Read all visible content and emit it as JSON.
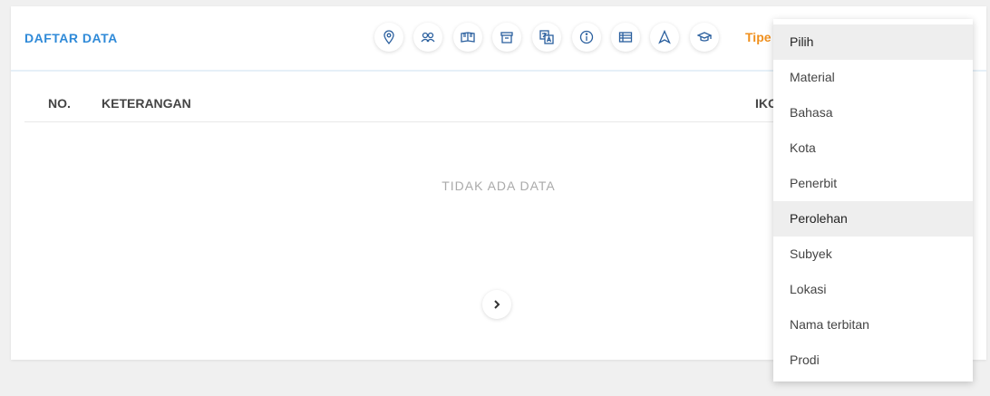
{
  "header": {
    "title": "DAFTAR DATA",
    "tipe_label": "Tipe"
  },
  "toolbar": {
    "icons": [
      {
        "name": "location-pin-icon"
      },
      {
        "name": "users-icon"
      },
      {
        "name": "book-open-icon"
      },
      {
        "name": "archive-box-icon"
      },
      {
        "name": "translate-icon"
      },
      {
        "name": "info-icon"
      },
      {
        "name": "table-icon"
      },
      {
        "name": "navigation-arrow-icon"
      },
      {
        "name": "graduation-cap-icon"
      }
    ]
  },
  "table": {
    "columns": [
      "NO.",
      "KETERANGAN",
      "IKO"
    ],
    "empty_text": "TIDAK ADA DATA"
  },
  "pagination": {
    "next_icon": "chevron-right-icon"
  },
  "dropdown": {
    "options": [
      "Pilih",
      "Material",
      "Bahasa",
      "Kota",
      "Penerbit",
      "Perolehan",
      "Subyek",
      "Lokasi",
      "Nama terbitan",
      "Prodi"
    ],
    "selected": "Pilih",
    "hovered": "Perolehan"
  },
  "colors": {
    "accent": "#2f8ad8",
    "orange": "#f0901e",
    "icon": "#2a5f9e"
  }
}
